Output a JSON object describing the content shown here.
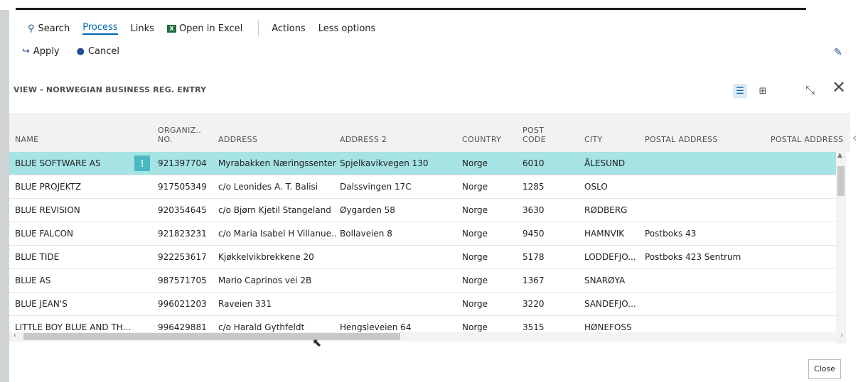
{
  "actions": {
    "search": "Search",
    "process": "Process",
    "links": "Links",
    "open_excel": "Open in Excel",
    "actions": "Actions",
    "less_options": "Less options"
  },
  "apply_bar": {
    "apply": "Apply",
    "cancel": "Cancel"
  },
  "view_title": "VIEW - NORWEGIAN BUSINESS REG. ENTRY",
  "columns": {
    "name": "NAME",
    "org_1": "ORGANIZ..",
    "org_2": "NO.",
    "address": "ADDRESS",
    "address2": "ADDRESS 2",
    "country": "COUNTRY",
    "post_1": "POST",
    "post_2": "CODE",
    "city": "CITY",
    "postal_address": "POSTAL ADDRESS",
    "postal_address2": "POSTAL ADDRESS"
  },
  "rows": [
    {
      "name": "BLUE SOFTWARE AS",
      "org": "921397704",
      "address": "Myrabakken Næringssenter",
      "address2": "Spjelkavikvegen 130",
      "country": "Norge",
      "post": "6010",
      "city": "ÅLESUND",
      "postal": ""
    },
    {
      "name": "BLUE PROJEKTZ",
      "org": "917505349",
      "address": "c/o Leonides A. T. Balisi",
      "address2": "Dalssvingen 17C",
      "country": "Norge",
      "post": "1285",
      "city": "OSLO",
      "postal": ""
    },
    {
      "name": "BLUE REVISION",
      "org": "920354645",
      "address": "c/o Bjørn Kjetil Stangeland",
      "address2": "Øygarden 58",
      "country": "Norge",
      "post": "3630",
      "city": "RØDBERG",
      "postal": ""
    },
    {
      "name": "BLUE FALCON",
      "org": "921823231",
      "address": "c/o Maria Isabel H Villanue...",
      "address2": "Bollaveien 8",
      "country": "Norge",
      "post": "9450",
      "city": "HAMNVIK",
      "postal": "Postboks 43"
    },
    {
      "name": "BLUE TIDE",
      "org": "922253617",
      "address": "Kjøkkelvikbrekkene 20",
      "address2": "",
      "country": "Norge",
      "post": "5178",
      "city": "LODDEFJO...",
      "postal": "Postboks 423 Sentrum"
    },
    {
      "name": "BLUE AS",
      "org": "987571705",
      "address": "Mario Caprinos vei 2B",
      "address2": "",
      "country": "Norge",
      "post": "1367",
      "city": "SNARØYA",
      "postal": ""
    },
    {
      "name": "BLUE JEAN'S",
      "org": "996021203",
      "address": "Raveien 331",
      "address2": "",
      "country": "Norge",
      "post": "3220",
      "city": "SANDEFJO...",
      "postal": ""
    },
    {
      "name": "LITTLE BOY BLUE AND TH...",
      "org": "996429881",
      "address": "c/o Harald Gythfeldt",
      "address2": "Hengsleveien 64",
      "country": "Norge",
      "post": "3515",
      "city": "HØNEFOSS",
      "postal": ""
    }
  ],
  "row_menu_glyph": "⋮",
  "close_button": "Close",
  "colors": {
    "accent": "#0066b3",
    "selected_row": "#a6e3e5",
    "row_menu": "#49b8bf"
  }
}
